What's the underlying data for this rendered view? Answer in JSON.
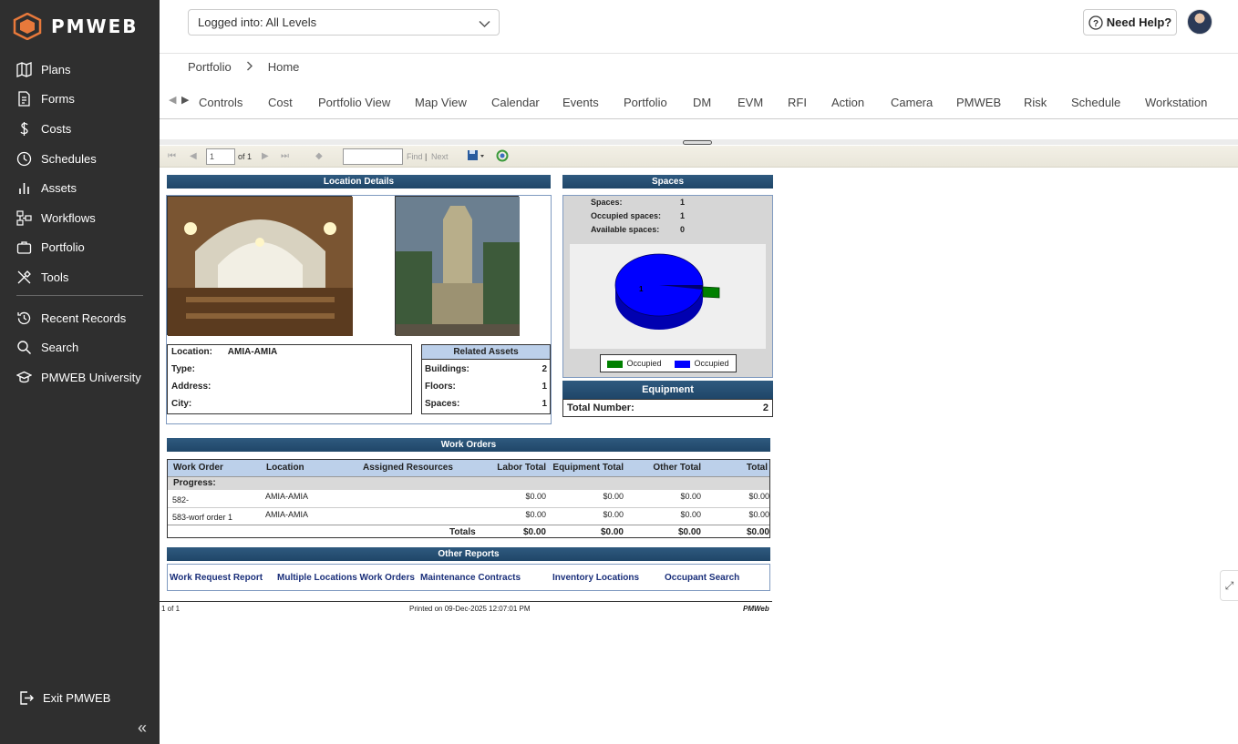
{
  "brand": {
    "logo_text": "PMWEB"
  },
  "sidebar": {
    "items": [
      {
        "label": "Plans",
        "icon": "map-icon"
      },
      {
        "label": "Forms",
        "icon": "document-icon"
      },
      {
        "label": "Costs",
        "icon": "dollar-icon"
      },
      {
        "label": "Schedules",
        "icon": "clock-icon"
      },
      {
        "label": "Assets",
        "icon": "bar-chart-icon"
      },
      {
        "label": "Workflows",
        "icon": "workflow-icon"
      },
      {
        "label": "Portfolio",
        "icon": "briefcase-icon"
      },
      {
        "label": "Tools",
        "icon": "tools-icon"
      }
    ],
    "secondary": [
      {
        "label": "Recent Records",
        "icon": "history-icon"
      },
      {
        "label": "Search",
        "icon": "search-icon"
      },
      {
        "label": "PMWEB University",
        "icon": "graduation-cap-icon"
      }
    ],
    "exit_label": "Exit PMWEB",
    "collapse_glyph": "«"
  },
  "header": {
    "level_select": "Logged into: All Levels",
    "help_label": "Need Help?"
  },
  "breadcrumb": {
    "parent": "Portfolio",
    "current": "Home"
  },
  "tabs": [
    "Controls",
    "Cost",
    "Portfolio View",
    "Map View",
    "Calendar",
    "Events",
    "Portfolio",
    "DM",
    "EVM",
    "RFI",
    "Action",
    "Camera",
    "PMWEB",
    "Risk",
    "Schedule",
    "Workstation"
  ],
  "report_toolbar": {
    "page_value": "1",
    "of_label": "of 1",
    "find_label": "Find",
    "next_label": "Next",
    "sep": "|"
  },
  "location_details": {
    "title": "Location Details",
    "fields": [
      {
        "label": "Location:",
        "value": "AMIA-AMIA"
      },
      {
        "label": "Type:",
        "value": ""
      },
      {
        "label": "Address:",
        "value": ""
      },
      {
        "label": "City:",
        "value": ""
      }
    ],
    "related_title": "Related Assets",
    "related": [
      {
        "label": "Buildings:",
        "value": "2"
      },
      {
        "label": "Floors:",
        "value": "1"
      },
      {
        "label": "Spaces:",
        "value": "1"
      }
    ]
  },
  "spaces": {
    "title": "Spaces",
    "rows": [
      {
        "label": "Spaces:",
        "value": "1"
      },
      {
        "label": "Occupied spaces:",
        "value": "1"
      },
      {
        "label": "Available spaces:",
        "value": "0"
      }
    ],
    "pie_label": "1",
    "legend": [
      {
        "label": "Occupied",
        "color": "#008000"
      },
      {
        "label": "Occupied",
        "color": "#0000ff"
      }
    ]
  },
  "equipment": {
    "title": "Equipment",
    "label": "Total Number:",
    "value": "2"
  },
  "work_orders": {
    "title": "Work Orders",
    "headers": [
      "Work Order",
      "Location",
      "Assigned Resources",
      "Labor Total",
      "Equipment Total",
      "Other Total",
      "Total"
    ],
    "progress_label": "Progress:",
    "rows": [
      [
        "582-",
        "AMIA-AMIA",
        "",
        "$0.00",
        "$0.00",
        "$0.00",
        "$0.00"
      ],
      [
        "583-worf order 1",
        "AMIA-AMIA",
        "",
        "$0.00",
        "$0.00",
        "$0.00",
        "$0.00"
      ]
    ],
    "totals_label": "Totals",
    "totals": [
      "$0.00",
      "$0.00",
      "$0.00",
      "$0.00"
    ]
  },
  "other_reports": {
    "title": "Other Reports",
    "links": [
      "Work Request Report",
      "Multiple Locations Work Orders",
      "Maintenance Contracts",
      "Inventory Locations",
      "Occupant Search"
    ]
  },
  "footer": {
    "page": "1 of 1",
    "printed": "Printed on 09-Dec-2025 12:07:01 PM",
    "brand": "PMWeb"
  },
  "colors": {
    "sidebar": "#2f2f2f",
    "section_header": "#1f4668",
    "pie_main": "#0000ff",
    "pie_slice": "#008000"
  }
}
